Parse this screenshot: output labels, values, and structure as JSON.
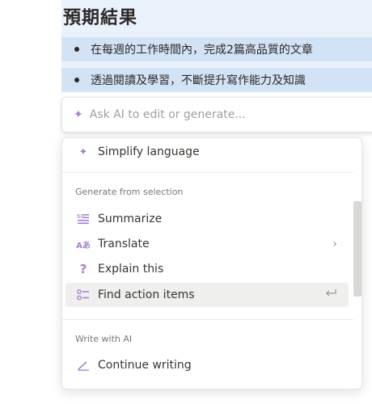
{
  "document": {
    "heading": "預期結果",
    "bullets": [
      "在每週的工作時間內，完成2篇高品質的文章",
      "透過閱讀及學習，不斷提升寫作能力及知識"
    ]
  },
  "ai_bar": {
    "placeholder": "Ask AI to edit or generate..."
  },
  "menu": {
    "simplify": "Simplify language",
    "section_generate": "Generate from selection",
    "summarize": "Summarize",
    "translate": "Translate",
    "explain": "Explain this",
    "find_action_items": "Find action items",
    "section_write": "Write with AI",
    "continue_writing": "Continue writing"
  },
  "colors": {
    "accent": "#a57fd4",
    "highlight_bg": "#d3e3f6"
  }
}
